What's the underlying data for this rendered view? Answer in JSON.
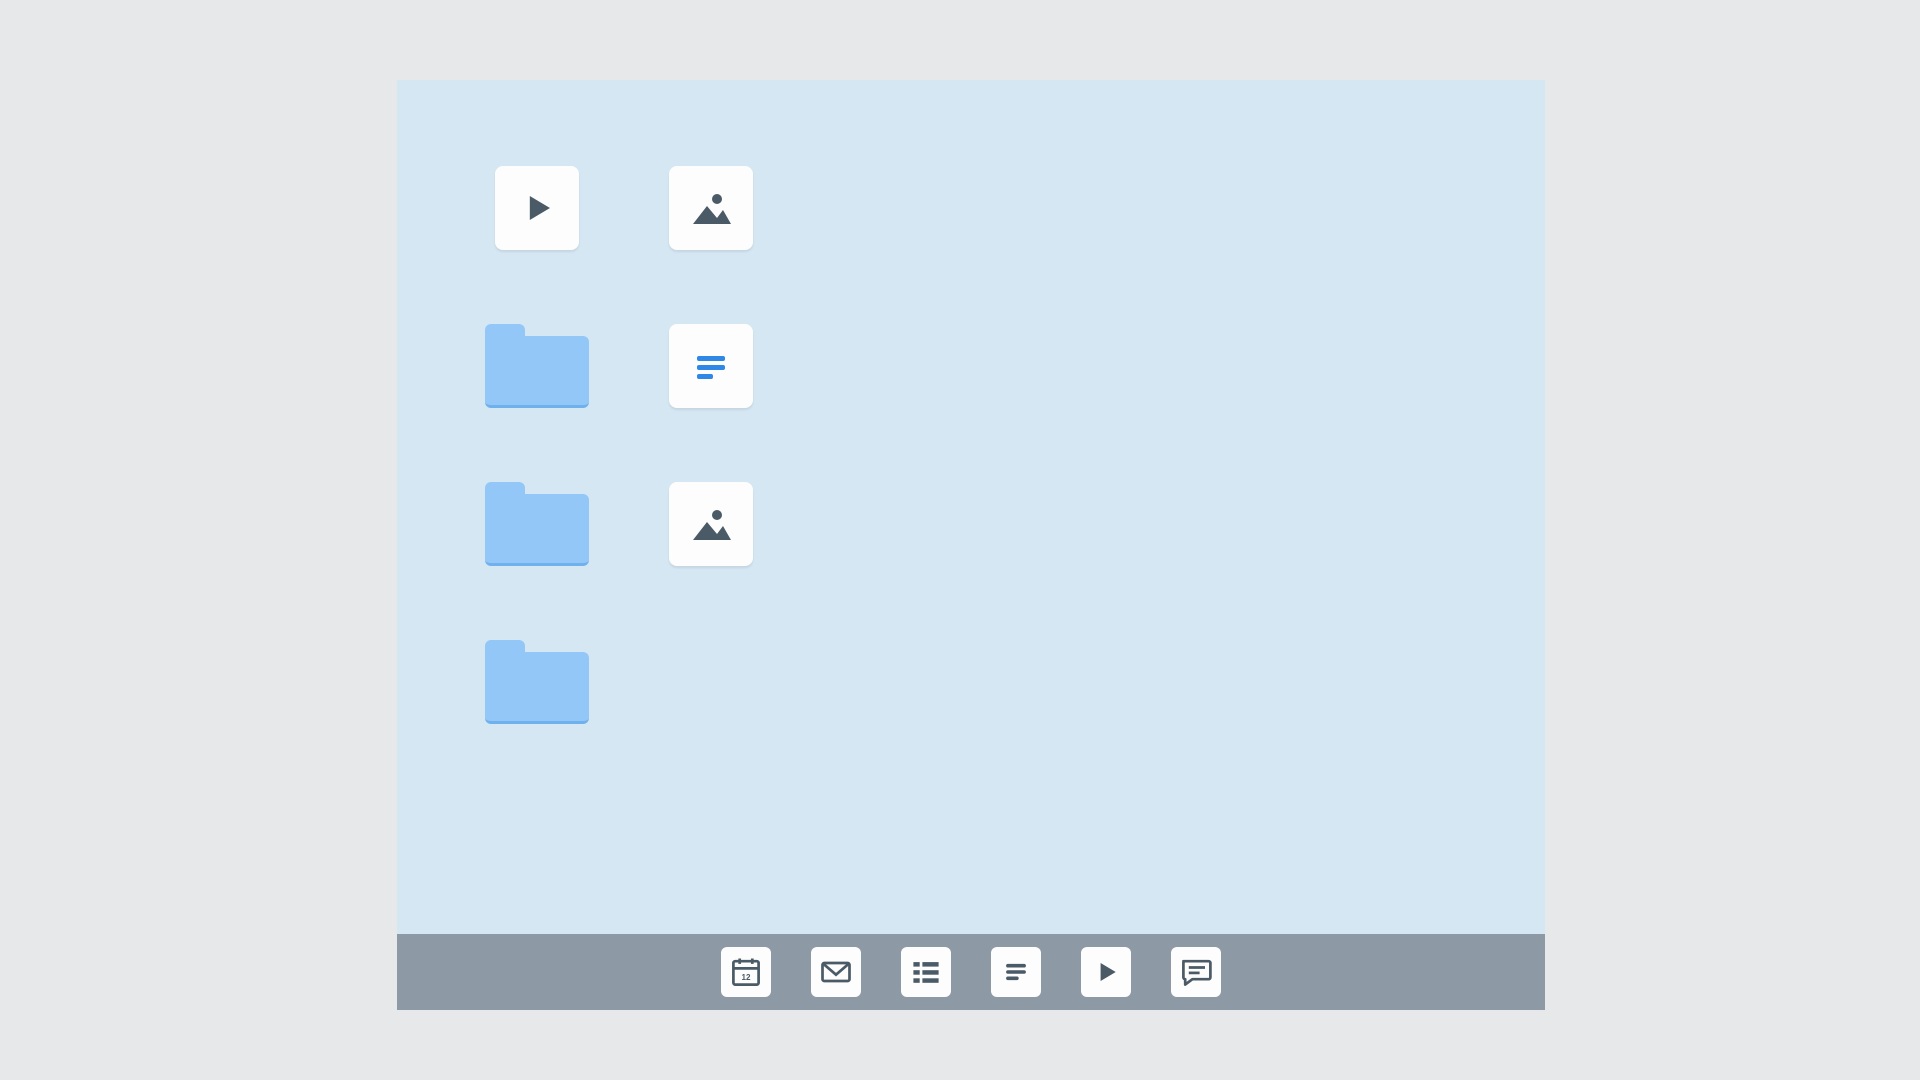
{
  "colors": {
    "page_bg": "#e7e8ea",
    "desktop_bg": "#d5e7f3",
    "tile_bg": "#fdfdfd",
    "folder_fill": "#93c7f7",
    "folder_shadow": "#6fb1ec",
    "taskbar_bg": "#8d99a4",
    "icon_dark": "#4a5a66",
    "icon_blue": "#2f87e6"
  },
  "desktop": {
    "grid": [
      {
        "row": 0,
        "col": 0,
        "type": "tile",
        "icon": "play",
        "name": "desktop-video-tile"
      },
      {
        "row": 0,
        "col": 1,
        "type": "tile",
        "icon": "image",
        "name": "desktop-image-tile-1"
      },
      {
        "row": 1,
        "col": 0,
        "type": "folder",
        "icon": "folder",
        "name": "desktop-folder-1"
      },
      {
        "row": 1,
        "col": 1,
        "type": "tile",
        "icon": "textdoc",
        "name": "desktop-textdoc-tile"
      },
      {
        "row": 2,
        "col": 0,
        "type": "folder",
        "icon": "folder",
        "name": "desktop-folder-2"
      },
      {
        "row": 2,
        "col": 1,
        "type": "tile",
        "icon": "image",
        "name": "desktop-image-tile-2"
      },
      {
        "row": 3,
        "col": 0,
        "type": "folder",
        "icon": "folder",
        "name": "desktop-folder-3"
      }
    ]
  },
  "taskbar": {
    "items": [
      {
        "icon": "calendar",
        "name": "taskbar-calendar"
      },
      {
        "icon": "mail",
        "name": "taskbar-mail"
      },
      {
        "icon": "list",
        "name": "taskbar-list"
      },
      {
        "icon": "textdoc",
        "name": "taskbar-textdoc"
      },
      {
        "icon": "play",
        "name": "taskbar-play"
      },
      {
        "icon": "chat",
        "name": "taskbar-chat"
      }
    ]
  }
}
